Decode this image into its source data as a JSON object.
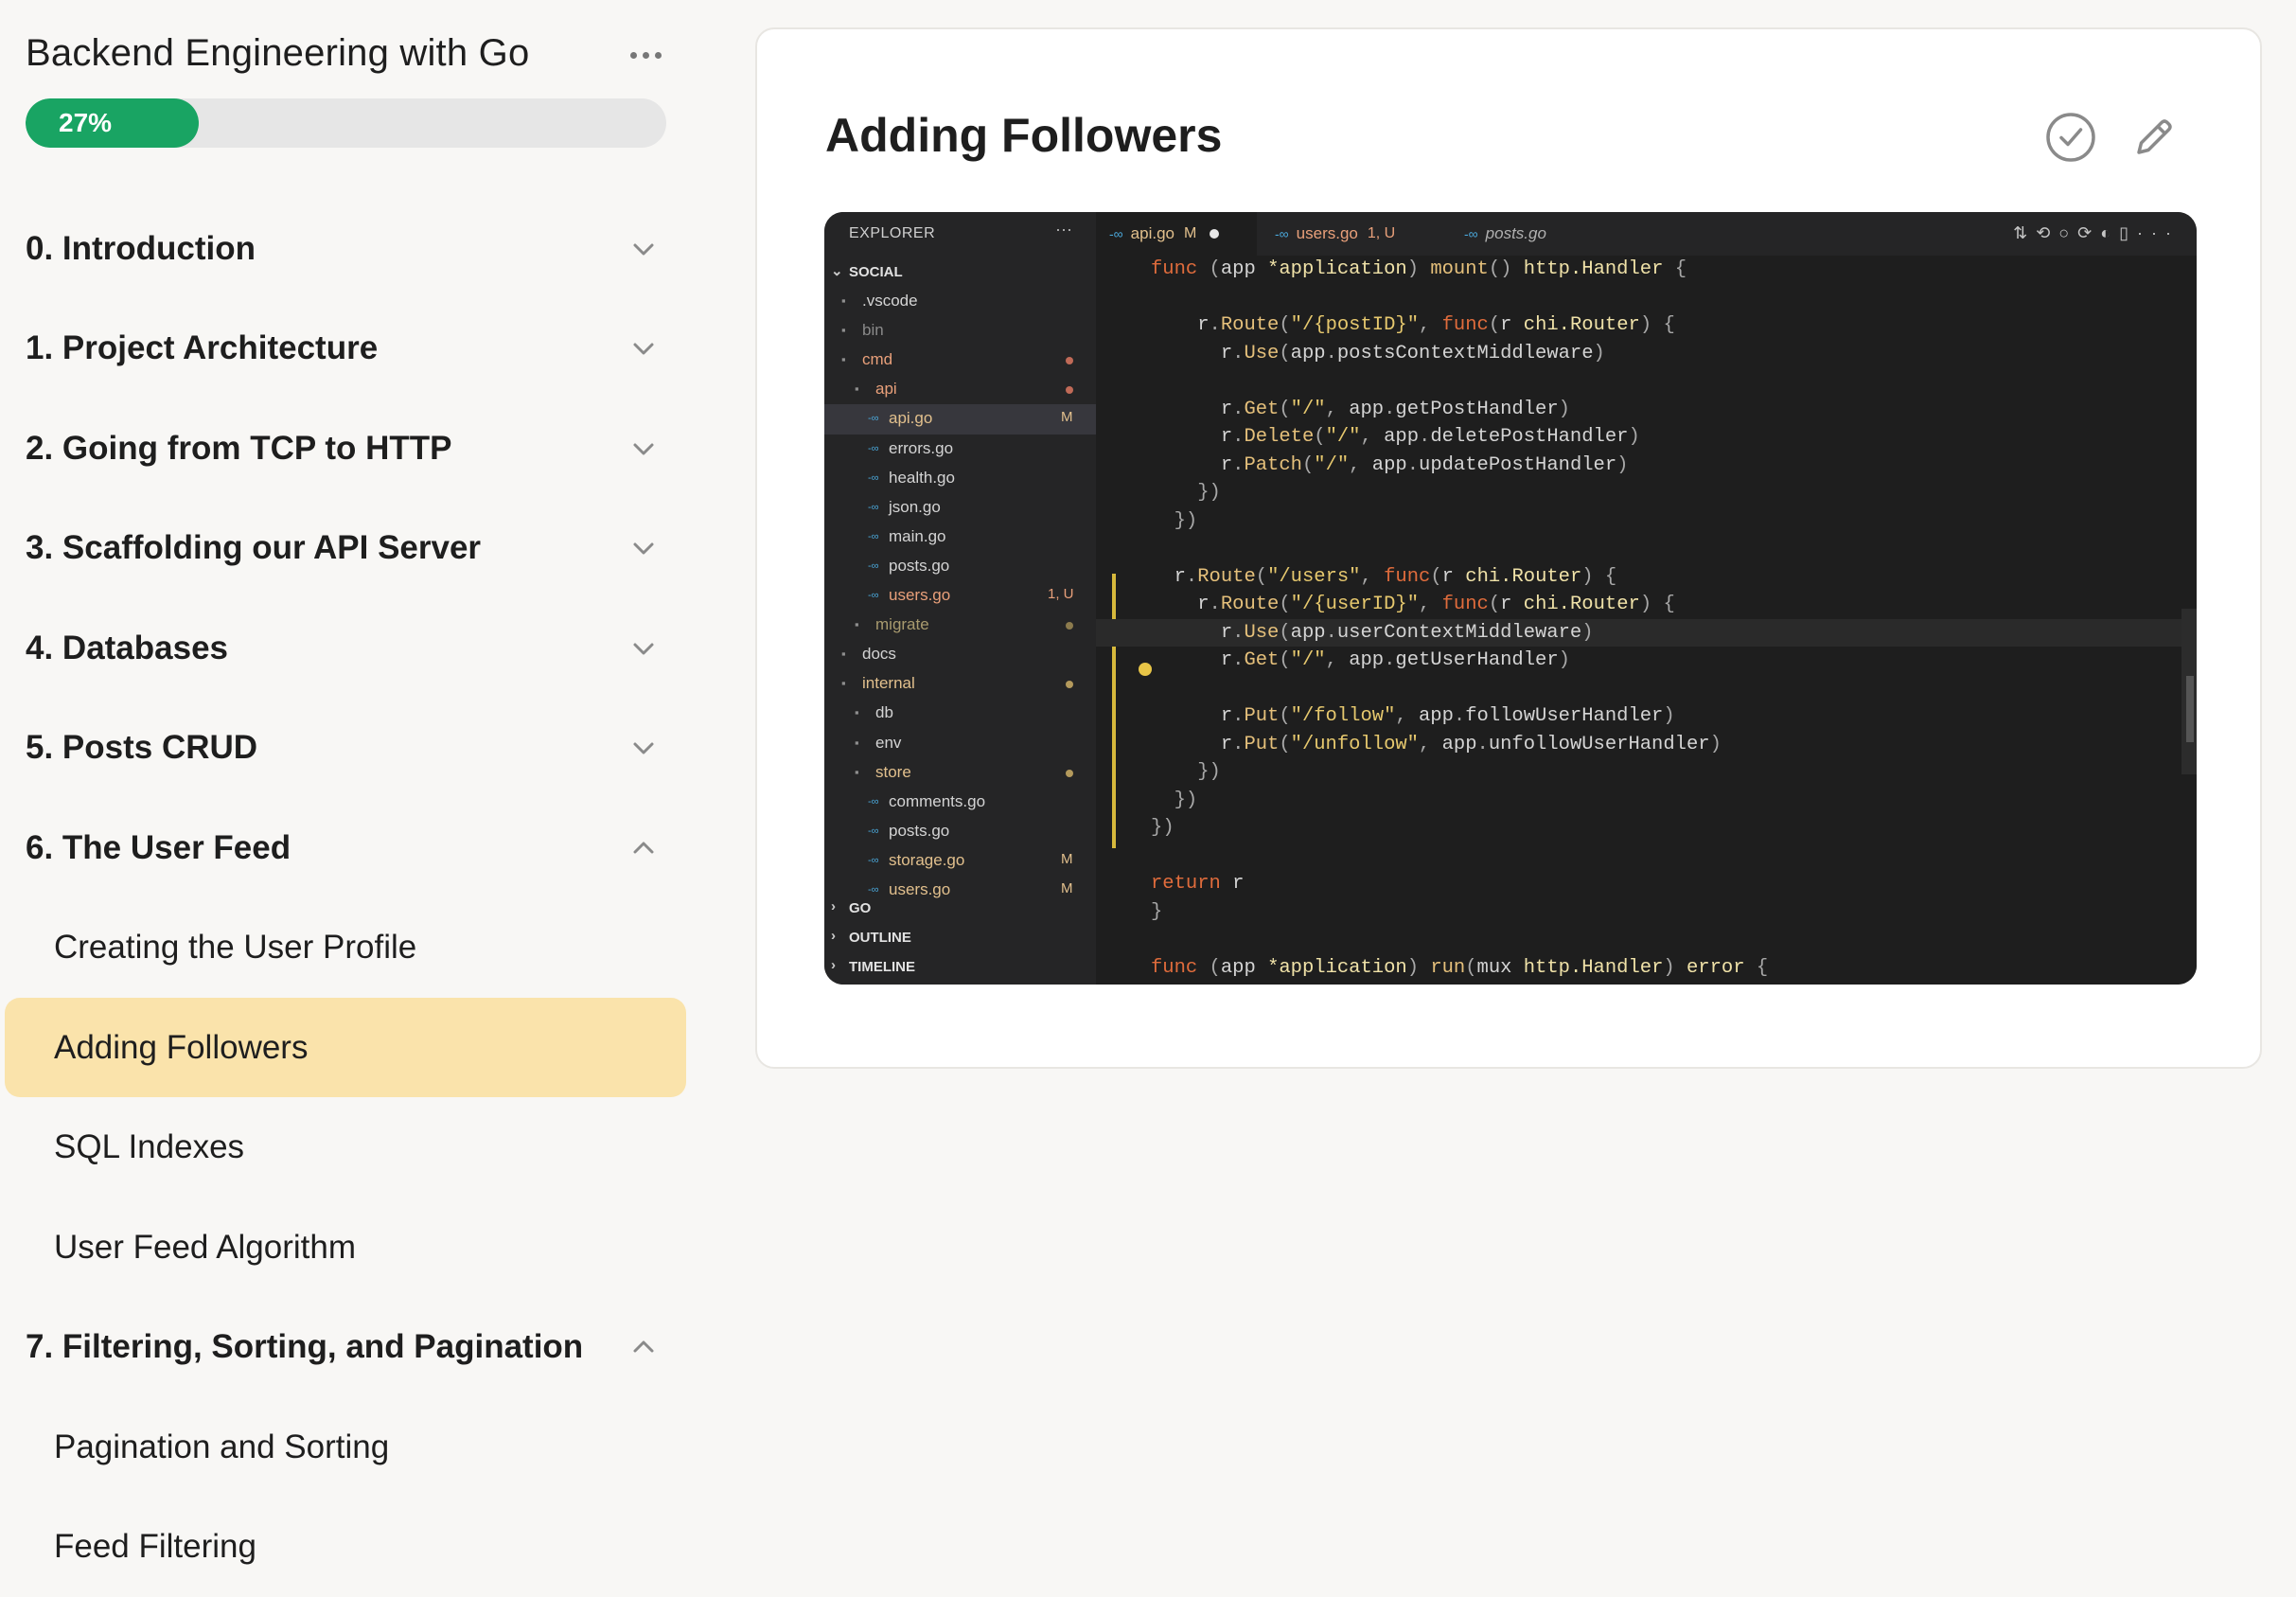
{
  "course": {
    "title": "Backend Engineering with Go",
    "progress_percent": 27,
    "progress_label": "27%"
  },
  "nav": [
    {
      "type": "section",
      "label": "0. Introduction",
      "expanded": false
    },
    {
      "type": "section",
      "label": "1. Project Architecture",
      "expanded": false
    },
    {
      "type": "section",
      "label": "2. Going from TCP to HTTP",
      "expanded": false
    },
    {
      "type": "section",
      "label": "3. Scaffolding our API Server",
      "expanded": false
    },
    {
      "type": "section",
      "label": "4. Databases",
      "expanded": false
    },
    {
      "type": "section",
      "label": "5. Posts CRUD",
      "expanded": false
    },
    {
      "type": "section",
      "label": "6. The User Feed",
      "expanded": true
    },
    {
      "type": "lesson",
      "label": "Creating the User Profile",
      "active": false
    },
    {
      "type": "lesson",
      "label": "Adding Followers",
      "active": true
    },
    {
      "type": "lesson",
      "label": "SQL Indexes",
      "active": false
    },
    {
      "type": "lesson",
      "label": "User Feed Algorithm",
      "active": false
    },
    {
      "type": "section",
      "label": "7. Filtering, Sorting, and Pagination",
      "expanded": true
    },
    {
      "type": "lesson",
      "label": "Pagination and Sorting",
      "active": false
    },
    {
      "type": "lesson",
      "label": "Feed Filtering",
      "active": false
    }
  ],
  "lesson": {
    "title": "Adding Followers"
  },
  "colors": {
    "progress_fill": "#19a463",
    "active_lesson_bg": "#fae3ab"
  },
  "video": {
    "explorer_title": "EXPLORER",
    "tree": [
      {
        "name": "SOCIAL",
        "kind": "root"
      },
      {
        "name": ".vscode",
        "kind": "folder",
        "depth": 0,
        "color": "#d4d4d4"
      },
      {
        "name": "bin",
        "kind": "folder",
        "depth": 0,
        "color": "#8a8a8a"
      },
      {
        "name": "cmd",
        "kind": "folder",
        "depth": 0,
        "color": "#e9a07a",
        "dot": "#c06a57"
      },
      {
        "name": "api",
        "kind": "folder",
        "depth": 1,
        "color": "#e9a07a",
        "dot": "#c06a57"
      },
      {
        "name": "api.go",
        "kind": "file",
        "depth": 2,
        "color": "#e2c08d",
        "badge": "M",
        "selected": true
      },
      {
        "name": "errors.go",
        "kind": "file",
        "depth": 2,
        "color": "#d4d4d4"
      },
      {
        "name": "health.go",
        "kind": "file",
        "depth": 2,
        "color": "#d4d4d4"
      },
      {
        "name": "json.go",
        "kind": "file",
        "depth": 2,
        "color": "#d4d4d4"
      },
      {
        "name": "main.go",
        "kind": "file",
        "depth": 2,
        "color": "#d4d4d4"
      },
      {
        "name": "posts.go",
        "kind": "file",
        "depth": 2,
        "color": "#d4d4d4"
      },
      {
        "name": "users.go",
        "kind": "file",
        "depth": 2,
        "color": "#e9a07a",
        "badge": "1, U"
      },
      {
        "name": "migrate",
        "kind": "folder",
        "depth": 1,
        "color": "#a99b6f",
        "dot": "#8c7b4d"
      },
      {
        "name": "docs",
        "kind": "folder",
        "depth": 0,
        "color": "#d4d4d4"
      },
      {
        "name": "internal",
        "kind": "folder",
        "depth": 0,
        "color": "#e2c08d",
        "dot": "#b49a5c"
      },
      {
        "name": "db",
        "kind": "folder",
        "depth": 1,
        "color": "#d4d4d4"
      },
      {
        "name": "env",
        "kind": "folder",
        "depth": 1,
        "color": "#d4d4d4"
      },
      {
        "name": "store",
        "kind": "folder",
        "depth": 1,
        "color": "#e2c08d",
        "dot": "#b49a5c"
      },
      {
        "name": "comments.go",
        "kind": "file",
        "depth": 2,
        "color": "#d4d4d4"
      },
      {
        "name": "posts.go",
        "kind": "file",
        "depth": 2,
        "color": "#d4d4d4"
      },
      {
        "name": "storage.go",
        "kind": "file",
        "depth": 2,
        "color": "#e2c08d",
        "badge": "M"
      },
      {
        "name": "users.go",
        "kind": "file",
        "depth": 2,
        "color": "#e2c08d",
        "badge": "M"
      }
    ],
    "bottom_sections": [
      "GO",
      "OUTLINE",
      "TIMELINE"
    ],
    "tabs": [
      {
        "name": "api.go",
        "badge": "M",
        "active": true,
        "modified_dot": true,
        "color": "#e2c08d"
      },
      {
        "name": "users.go",
        "badge": "1, U",
        "active": false,
        "color": "#e9a07a"
      },
      {
        "name": "posts.go",
        "badge": "",
        "active": false,
        "color": "#b0b0b0"
      }
    ],
    "code_lines": [
      "func (app *application) mount() http.Handler {",
      "",
      "    r.Route(\"/{postID}\", func(r chi.Router) {",
      "      r.Use(app.postsContextMiddleware)",
      "",
      "      r.Get(\"/\", app.getPostHandler)",
      "      r.Delete(\"/\", app.deletePostHandler)",
      "      r.Patch(\"/\", app.updatePostHandler)",
      "    })",
      "  })",
      "",
      "  r.Route(\"/users\", func(r chi.Router) {",
      "    r.Route(\"/{userID}\", func(r chi.Router) {",
      "      r.Use(app.userContextMiddleware)",
      "      r.Get(\"/\", app.getUserHandler)",
      "",
      "      r.Put(\"/follow\", app.followUserHandler)",
      "      r.Put(\"/unfollow\", app.unfollowUserHandler)",
      "    })",
      "  })",
      "})",
      "",
      "return r",
      "}",
      "",
      "func (app *application) run(mux http.Handler) error {"
    ]
  }
}
